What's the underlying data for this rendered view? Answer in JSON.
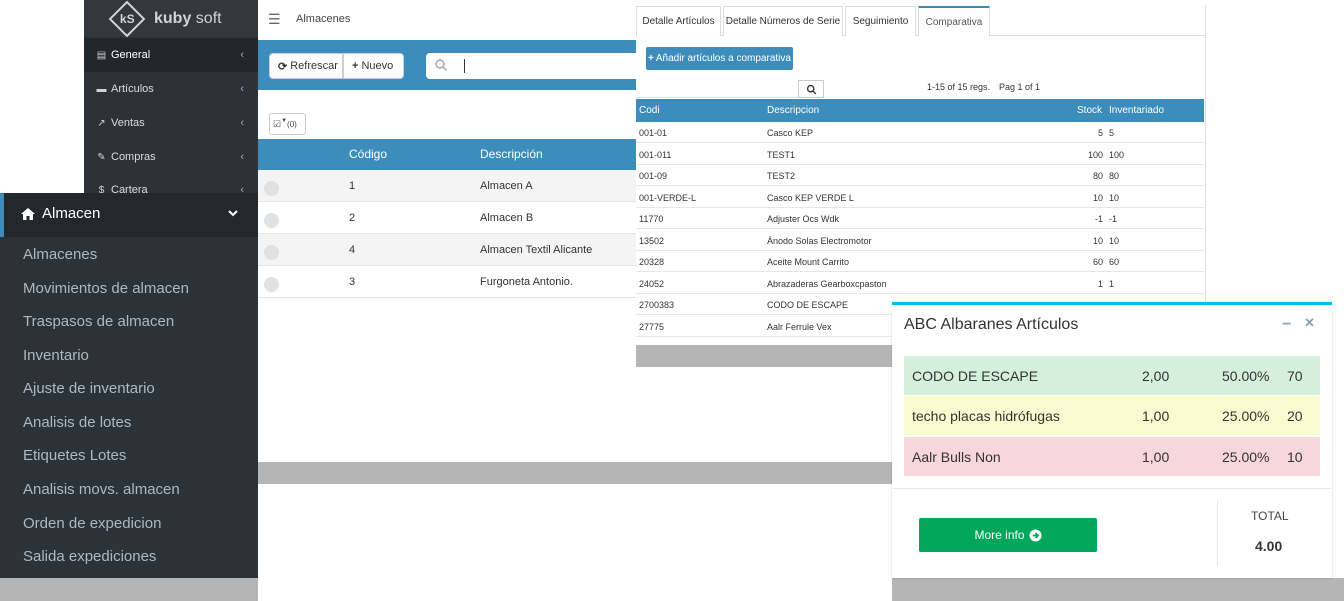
{
  "brand": {
    "logo_mark": "kS",
    "name_bold": "kuby",
    "name_rest": " soft"
  },
  "top_sidebar": {
    "items": [
      {
        "label": "General",
        "icon": "id-card-icon"
      },
      {
        "label": "Artículos",
        "icon": "archive-icon"
      },
      {
        "label": "Ventas",
        "icon": "external-link-icon"
      },
      {
        "label": "Compras",
        "icon": "edit-icon"
      },
      {
        "label": "Cartera",
        "icon": "dollar-icon"
      }
    ]
  },
  "header": {
    "title": "Almacenes"
  },
  "toolbar": {
    "refresh_label": "Refrescar",
    "new_label": "Nuevo",
    "select_count": "(0)"
  },
  "almacenes_table": {
    "columns": [
      "Código",
      "Descripción"
    ],
    "rows": [
      {
        "code": "1",
        "desc": "Almacen A"
      },
      {
        "code": "2",
        "desc": "Almacen B"
      },
      {
        "code": "4",
        "desc": "Almacen Textil Alicante"
      },
      {
        "code": "3",
        "desc": "Furgoneta Antonio."
      }
    ]
  },
  "almacen_menu": {
    "title": "Almacen",
    "items": [
      "Almacenes",
      "Movimientos de almacen",
      "Traspasos de almacen",
      "Inventario",
      "Ajuste de inventario",
      "Analisis de lotes",
      "Etiquetes Lotes",
      "Analisis movs. almacen",
      "Orden de expedicion",
      "Salida expediciones"
    ]
  },
  "comparativa": {
    "tabs": [
      "Detalle Artículos",
      "Detalle Números de Serie",
      "Seguimiento",
      "Comparativa"
    ],
    "active_tab": "Comparativa",
    "add_button": "Añadir artículos a comparativa",
    "regs": "1-15 of 15 regs.",
    "page": "Pag 1 of 1",
    "columns": [
      "Codi",
      "Descripcion",
      "Stock",
      "Inventariado"
    ],
    "rows": [
      {
        "code": "001-01",
        "desc": "Casco KEP",
        "stock": "5",
        "inv": "5"
      },
      {
        "code": "001-011",
        "desc": "TEST1",
        "stock": "100",
        "inv": "100"
      },
      {
        "code": "001-09",
        "desc": "TEST2",
        "stock": "80",
        "inv": "80"
      },
      {
        "code": "001-VERDE-L",
        "desc": "Casco KEP VERDE L",
        "stock": "10",
        "inv": "10"
      },
      {
        "code": "11770",
        "desc": "Adjuster Ocs Wdk",
        "stock": "-1",
        "inv": "-1"
      },
      {
        "code": "13502",
        "desc": "Ánodo Solas Electromotor",
        "stock": "10",
        "inv": "10"
      },
      {
        "code": "20328",
        "desc": "Aceite Mount Carrito",
        "stock": "60",
        "inv": "60"
      },
      {
        "code": "24052",
        "desc": "Abrazaderas Gearboxcpaston",
        "stock": "1",
        "inv": "1"
      },
      {
        "code": "2700383",
        "desc": "CODO DE ESCAPE",
        "stock": "",
        "inv": ""
      },
      {
        "code": "27775",
        "desc": "Aalr Ferrule Vex",
        "stock": "",
        "inv": ""
      }
    ]
  },
  "abc_widget": {
    "title": "ABC Albaranes Artículos",
    "rows": [
      {
        "name": "CODO DE ESCAPE",
        "qty": "2,00",
        "pct": "50.00%",
        "score": "70",
        "color": "#d4f0dc"
      },
      {
        "name": "techo placas hidrófugas",
        "qty": "1,00",
        "pct": "25.00%",
        "score": "20",
        "color": "#fafad0"
      },
      {
        "name": "Aalr Bulls Non",
        "qty": "1,00",
        "pct": "25.00%",
        "score": "10",
        "color": "#f8d7da"
      }
    ],
    "more_info": "More info",
    "total_label": "TOTAL",
    "total_value": "4.00"
  },
  "colors": {
    "primary": "#3c8dbc",
    "sidebar": "#2c3338",
    "success": "#00a65a",
    "info": "#00c0ef"
  }
}
